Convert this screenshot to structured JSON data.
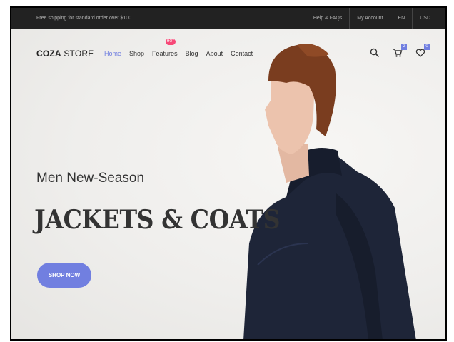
{
  "topbar": {
    "promo": "Free shipping for standard order over $100",
    "links": [
      "Help & FAQs",
      "My Account",
      "EN",
      "USD"
    ]
  },
  "header": {
    "logo_bold": "COZA",
    "logo_rest": " STORE",
    "menu": [
      "Home",
      "Shop",
      "Features",
      "Blog",
      "About",
      "Contact"
    ],
    "active_item": "Home",
    "hot_label": "HOT",
    "cart_count": "2",
    "wishlist_count": "0",
    "icons": [
      "search-icon",
      "cart-icon",
      "heart-icon"
    ]
  },
  "hero": {
    "subtitle": "Men New-Season",
    "title": "JACKETS & COATS",
    "cta": "SHOP NOW"
  },
  "colors": {
    "accent": "#717fe0",
    "hot": "#f74877",
    "topbar": "#222222"
  }
}
